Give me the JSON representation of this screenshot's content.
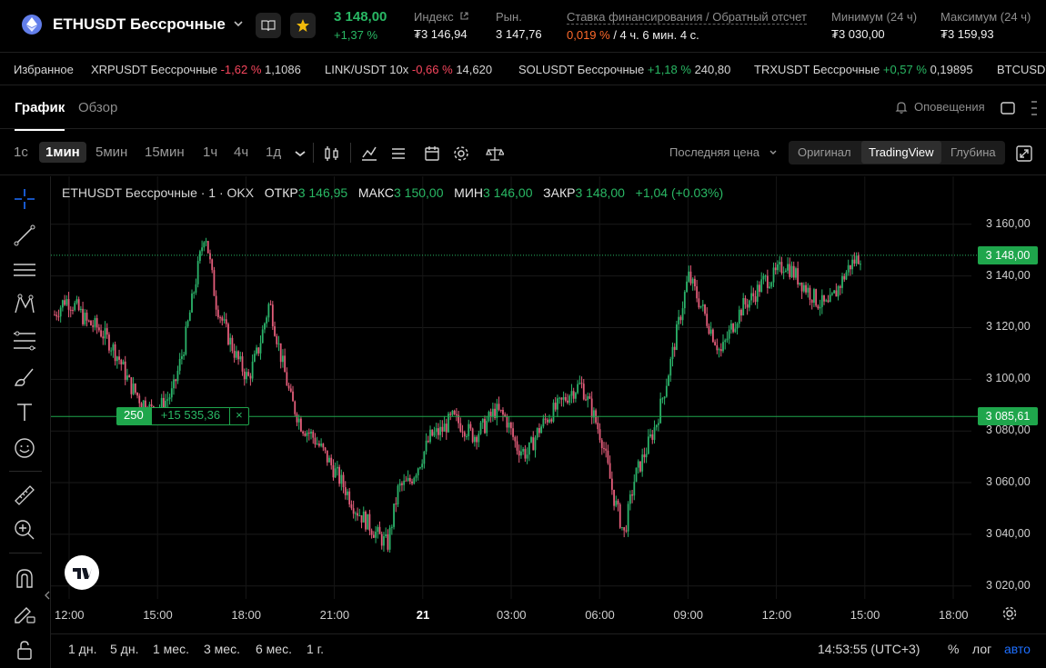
{
  "header": {
    "pair": "ETHUSDT Бессрочные",
    "last_price": "3 148,00",
    "change_pct": "+1,37 %",
    "index_label": "Индекс",
    "index_value": "₮3 146,94",
    "mark_label": "Рын.",
    "mark_value": "3 147,76",
    "funding_label": "Ставка финансирования / Обратный отсчет",
    "funding_rate": "0,019 %",
    "funding_countdown": "/ 4 ч. 6 мин. 4 с.",
    "low_label": "Минимум (24 ч)",
    "low_value": "₮3 030,00",
    "high_label": "Максимум (24 ч)",
    "high_value": "₮3 159,93"
  },
  "ticker": {
    "favorites_label": "Избранное",
    "items": [
      {
        "name": "XRPUSDT Бессрочные",
        "change": "-1,62 %",
        "price": "1,1086",
        "dir": "neg"
      },
      {
        "name": "LINK/USDT 10x",
        "change": "-0,66 %",
        "price": "14,620",
        "dir": "neg"
      },
      {
        "name": "SOLUSDT Бессрочные",
        "change": "+1,18 %",
        "price": "240,80",
        "dir": "pos"
      },
      {
        "name": "TRXUSDT Бессрочные",
        "change": "+0,57 %",
        "price": "0,19895",
        "dir": "pos"
      },
      {
        "name": "BTCUSDT",
        "change": "",
        "price": "",
        "dir": "pos"
      }
    ]
  },
  "tabs": {
    "chart": "График",
    "overview": "Обзор",
    "alerts": "Оповещения"
  },
  "toolbar": {
    "timeframes": [
      "1с",
      "1мин",
      "5мин",
      "15мин",
      "1ч",
      "4ч",
      "1д"
    ],
    "active_timeframe": "1мин",
    "price_source": "Последняя цена",
    "views": [
      "Оригинал",
      "TradingView",
      "Глубина"
    ],
    "active_view": "TradingView"
  },
  "legend": {
    "title": "ETHUSDT Бессрочные · 1 · OKX",
    "open_label": "ОТКР",
    "open": "3 146,95",
    "high_label": "МАКС",
    "high": "3 150,00",
    "low_label": "МИН",
    "low": "3 146,00",
    "close_label": "ЗАКР",
    "close": "3 148,00",
    "change": "+1,04 (+0.03%)"
  },
  "position": {
    "quantity": "250",
    "pnl": "+15 535,36",
    "entry_price": "3 085,61",
    "close_symbol": "×"
  },
  "bottom": {
    "ranges": [
      "1 дн.",
      "5 дн.",
      "1 мес.",
      "3 мес.",
      "6 мес.",
      "1 г."
    ],
    "clock": "14:53:55 (UTC+3)",
    "pct": "%",
    "log": "лог",
    "auto": "авто"
  },
  "colors": {
    "up": "#29b864",
    "down": "#f6465d",
    "accent_blue": "#1e6fff",
    "funding": "#ff6a2b"
  },
  "chart_data": {
    "type": "candlestick",
    "title": "ETHUSDT Бессрочные · 1 · OKX",
    "y_ticks": [
      "3 160,00",
      "3 140,00",
      "3 120,00",
      "3 100,00",
      "3 080,00",
      "3 060,00",
      "3 040,00",
      "3 020,00"
    ],
    "x_ticks": [
      "12:00",
      "15:00",
      "18:00",
      "21:00",
      "21",
      "03:00",
      "06:00",
      "09:00",
      "12:00",
      "15:00",
      "18:00"
    ],
    "ylim": [
      3015,
      3168
    ],
    "last_price": 3148.0,
    "last_price_label": "3 148,00",
    "entry_price": 3085.61,
    "entry_price_label": "3 085,61",
    "time_range": [
      "12:00",
      "18:00"
    ],
    "series": [
      {
        "values_close_approx": [
          3125,
          3131,
          3128,
          3122,
          3120,
          3115,
          3108,
          3098,
          3092,
          3088,
          3090,
          3095,
          3112,
          3135,
          3158,
          3130,
          3118,
          3108,
          3100,
          3112,
          3130,
          3110,
          3092,
          3082,
          3078,
          3072,
          3065,
          3058,
          3050,
          3045,
          3040,
          3036,
          3058,
          3060,
          3068,
          3078,
          3080,
          3085,
          3082,
          3078,
          3082,
          3088,
          3085,
          3074,
          3071,
          3080,
          3086,
          3090,
          3095,
          3098,
          3088,
          3076,
          3055,
          3040,
          3062,
          3072,
          3083,
          3100,
          3120,
          3140,
          3130,
          3120,
          3110,
          3120,
          3128,
          3132,
          3138,
          3140,
          3145,
          3140,
          3135,
          3130,
          3128,
          3136,
          3144,
          3148
        ]
      }
    ],
    "grid": true,
    "legend": "top-left"
  }
}
